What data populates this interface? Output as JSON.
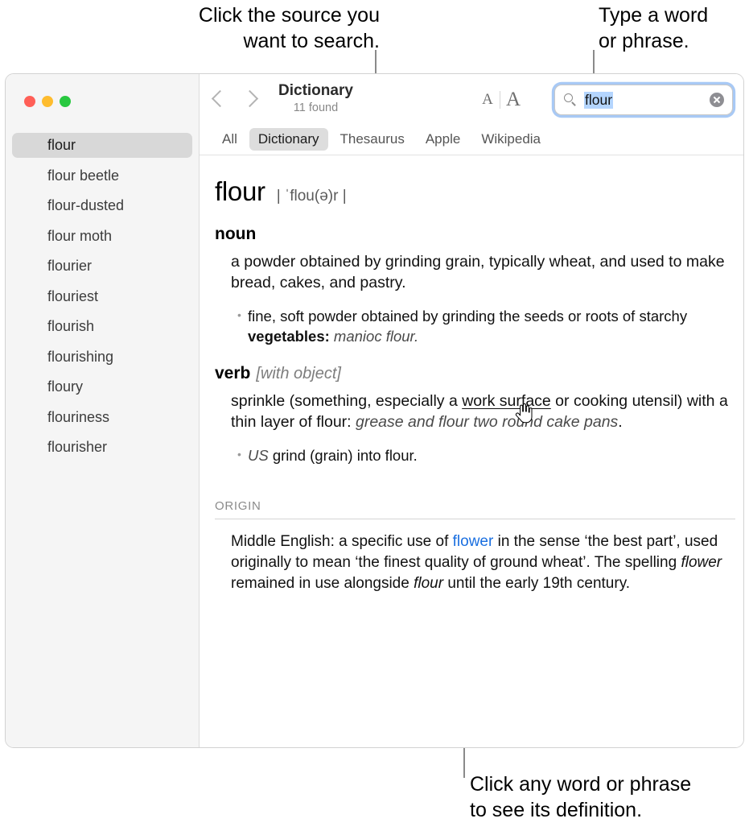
{
  "callouts": {
    "source": "Click the source you\nwant to search.",
    "type_word": "Type a word\nor phrase.",
    "click_word": "Click any word or phrase\nto see its definition."
  },
  "window": {
    "traffic_lights": {
      "close": "close",
      "minimize": "minimize",
      "zoom": "zoom"
    }
  },
  "sidebar": {
    "items": [
      {
        "label": "flour",
        "selected": true
      },
      {
        "label": "flour beetle",
        "selected": false
      },
      {
        "label": "flour-dusted",
        "selected": false
      },
      {
        "label": "flour moth",
        "selected": false
      },
      {
        "label": "flourier",
        "selected": false
      },
      {
        "label": "flouriest",
        "selected": false
      },
      {
        "label": "flourish",
        "selected": false
      },
      {
        "label": "flourishing",
        "selected": false
      },
      {
        "label": "floury",
        "selected": false
      },
      {
        "label": "flouriness",
        "selected": false
      },
      {
        "label": "flourisher",
        "selected": false
      }
    ]
  },
  "toolbar": {
    "back_label": "Back",
    "forward_label": "Forward",
    "title": "Dictionary",
    "subtitle": "11 found",
    "font_small": "A",
    "font_large": "A"
  },
  "search": {
    "value": "flour",
    "placeholder": "Search",
    "clear_label": "Clear search"
  },
  "tabs": [
    {
      "label": "All",
      "active": false
    },
    {
      "label": "Dictionary",
      "active": true
    },
    {
      "label": "Thesaurus",
      "active": false
    },
    {
      "label": "Apple",
      "active": false
    },
    {
      "label": "Wikipedia",
      "active": false
    }
  ],
  "entry": {
    "headword": "flour",
    "pronunciation": "| ˈflou(ə)r |",
    "noun": {
      "pos": "noun",
      "sense": "a powder obtained by grinding grain, typically wheat, and used to make bread, cakes, and pastry.",
      "subsense_text": "fine, soft powder obtained by grinding the seeds or roots of starchy ",
      "subsense_bold": "vegetables:",
      "subsense_example": " manioc flour."
    },
    "verb": {
      "pos": "verb",
      "grammar": "[with object]",
      "sense_part1": "sprinkle (something, especially a ",
      "sense_link": "work surface",
      "sense_part2": " or cooking utensil) with a thin layer of flour: ",
      "sense_example": "grease and flour two round cake pans",
      "sense_end": ".",
      "subsense_label": "US",
      "subsense_text": " grind (grain) into flour."
    },
    "origin": {
      "label": "ORIGIN",
      "part1": "Middle English: a specific use of ",
      "link": "flower",
      "part2": " in the sense ‘the best part’, used originally to mean ‘the finest quality of ground wheat’. The spelling ",
      "italic1": "flower",
      "part3": " remained in use alongside ",
      "italic2": "flour",
      "part4": " until the early 19th century."
    }
  },
  "colors": {
    "accent_link": "#1a6fe0",
    "focus_ring": "#a8c9f5",
    "selection": "#b4d5fe",
    "sidebar_bg": "#f5f5f5",
    "tab_active_bg": "#dddddd",
    "row_selected_bg": "#d8d8d8"
  }
}
